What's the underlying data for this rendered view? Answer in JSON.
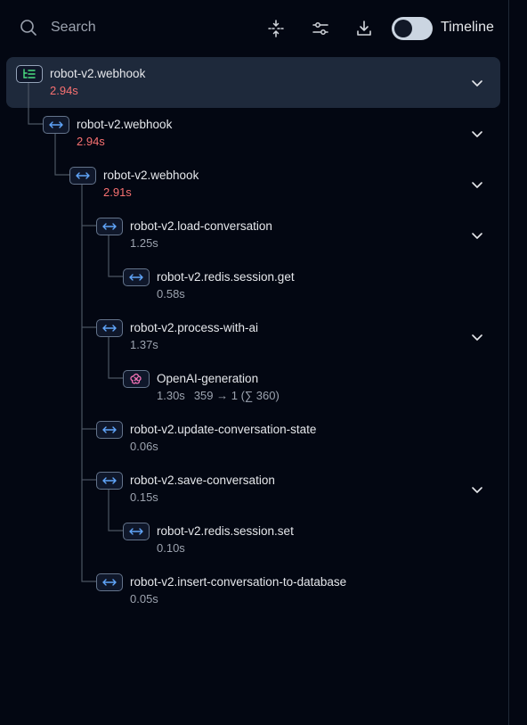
{
  "toolbar": {
    "search_label": "Search",
    "timeline_label": "Timeline",
    "timeline_enabled": false,
    "icons": [
      "search-icon",
      "collapse-all-icon",
      "filter-settings-icon",
      "download-icon"
    ]
  },
  "colors": {
    "background": "#030712",
    "selected_row": "#1e293b",
    "duration_error": "#f87171",
    "span_icon": "#60a5fa",
    "generation_icon": "#f472b6",
    "trace_icon": "#4ade80"
  },
  "tree": [
    {
      "id": "n0",
      "kind": "trace",
      "icon": "trace-list-icon",
      "name": "robot-v2.webhook",
      "duration": "2.94s",
      "error": true,
      "selected": true,
      "expandable": true
    },
    {
      "id": "n1",
      "kind": "span",
      "icon": "span-arrows-icon",
      "name": "robot-v2.webhook",
      "duration": "2.94s",
      "error": true,
      "expandable": true
    },
    {
      "id": "n2",
      "kind": "span",
      "icon": "span-arrows-icon",
      "name": "robot-v2.webhook",
      "duration": "2.91s",
      "error": true,
      "expandable": true
    },
    {
      "id": "n3",
      "kind": "span",
      "icon": "span-arrows-icon",
      "name": "robot-v2.load-conversation",
      "duration": "1.25s",
      "error": false,
      "expandable": true
    },
    {
      "id": "n4",
      "kind": "span",
      "icon": "span-arrows-icon",
      "name": "robot-v2.redis.session.get",
      "duration": "0.58s",
      "error": false,
      "expandable": false
    },
    {
      "id": "n5",
      "kind": "span",
      "icon": "span-arrows-icon",
      "name": "robot-v2.process-with-ai",
      "duration": "1.37s",
      "error": false,
      "expandable": true
    },
    {
      "id": "n6",
      "kind": "generation",
      "icon": "generation-icon",
      "name": "OpenAI-generation",
      "duration": "1.30s",
      "tokens": "359 → 1 (∑ 360)",
      "error": false,
      "expandable": false
    },
    {
      "id": "n7",
      "kind": "span",
      "icon": "span-arrows-icon",
      "name": "robot-v2.update-conversation-state",
      "duration": "0.06s",
      "error": false,
      "expandable": false
    },
    {
      "id": "n8",
      "kind": "span",
      "icon": "span-arrows-icon",
      "name": "robot-v2.save-conversation",
      "duration": "0.15s",
      "error": false,
      "expandable": true
    },
    {
      "id": "n9",
      "kind": "span",
      "icon": "span-arrows-icon",
      "name": "robot-v2.redis.session.set",
      "duration": "0.10s",
      "error": false,
      "expandable": false
    },
    {
      "id": "n10",
      "kind": "span",
      "icon": "span-arrows-icon",
      "name": "robot-v2.insert-conversation-to-database",
      "duration": "0.05s",
      "error": false,
      "expandable": false
    }
  ]
}
